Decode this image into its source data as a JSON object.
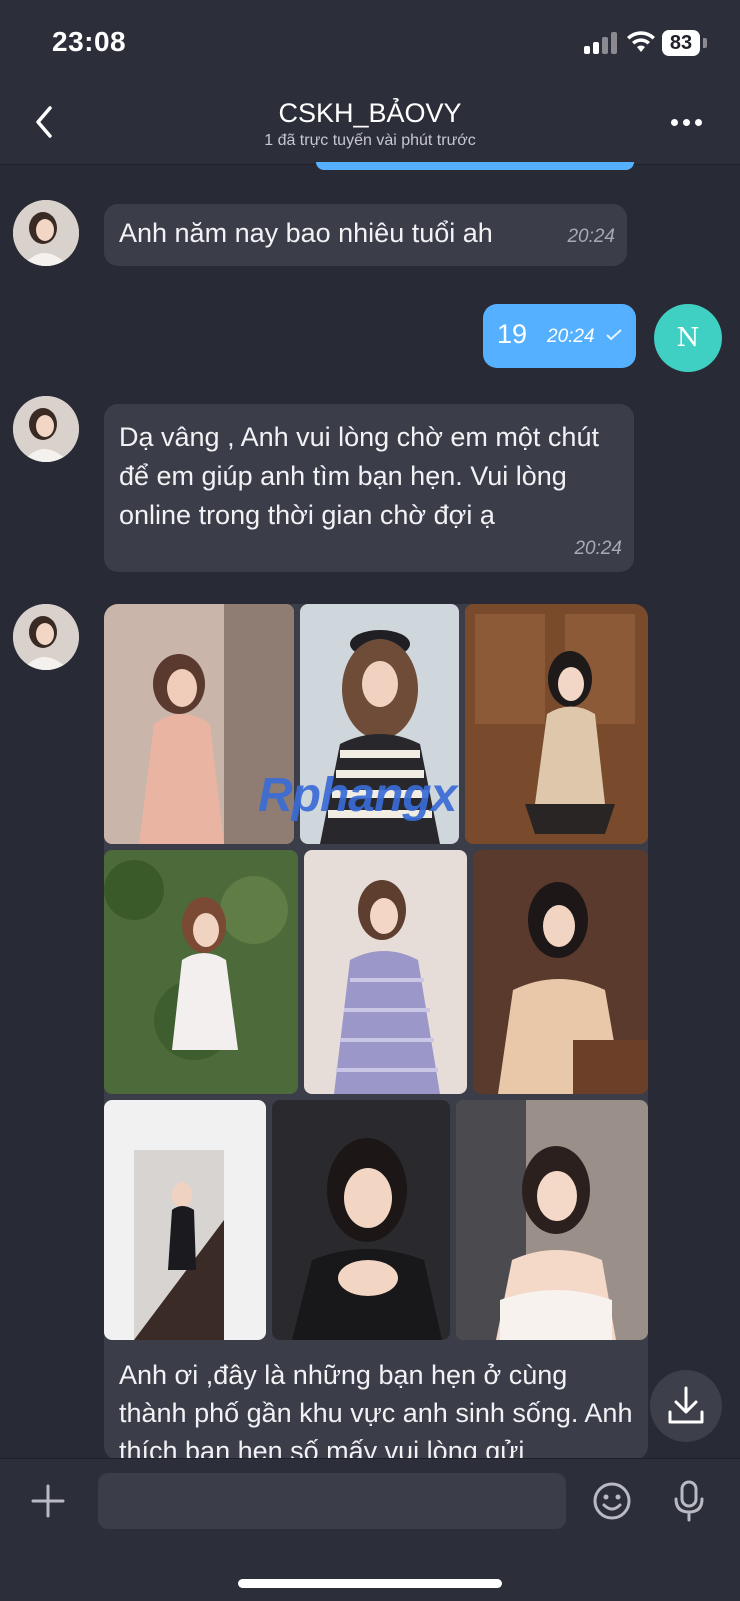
{
  "status_bar": {
    "time": "23:08",
    "battery": "83",
    "icons": [
      "signal-icon",
      "wifi-icon",
      "battery-icon"
    ]
  },
  "header": {
    "back_icon": "chevron-left-icon",
    "title": "CSKH_BẢOVY",
    "subtitle": "1 đã trực tuyến vài phút trước",
    "menu_icon": "more-dots-icon"
  },
  "messages": [
    {
      "sender": "contact",
      "text": "Anh năm  nay bao nhiêu tuổi ah",
      "time": "20:24"
    },
    {
      "sender": "me",
      "text": "19",
      "time": "20:24",
      "avatar_initial": "N"
    },
    {
      "sender": "contact",
      "text": "Dạ vâng , Anh vui lòng chờ em một chút để em giúp anh tìm bạn hẹn. Vui lòng online trong thời gian chờ đợi ạ",
      "time": "20:24"
    },
    {
      "sender": "contact",
      "type": "photo-collage",
      "photo_count": 9,
      "watermark": "Rphangx",
      "text": "Anh ơi ,đây là những bạn hẹn ở cùng thành phố gần khu vực anh sinh sống. Anh thích bạn hẹn số mấy vui lòng gửi"
    }
  ],
  "composer": {
    "plus_icon": "plus-icon",
    "input_value": "",
    "emoji_icon": "emoji-icon",
    "mic_icon": "microphone-icon",
    "download_icon": "download-icon"
  },
  "colors": {
    "background": "#282a35",
    "bar": "#2c2e39",
    "incoming_bubble": "#3b3d49",
    "outgoing_bubble": "#55b1ff",
    "avatar_n": "#3fcfc3"
  }
}
